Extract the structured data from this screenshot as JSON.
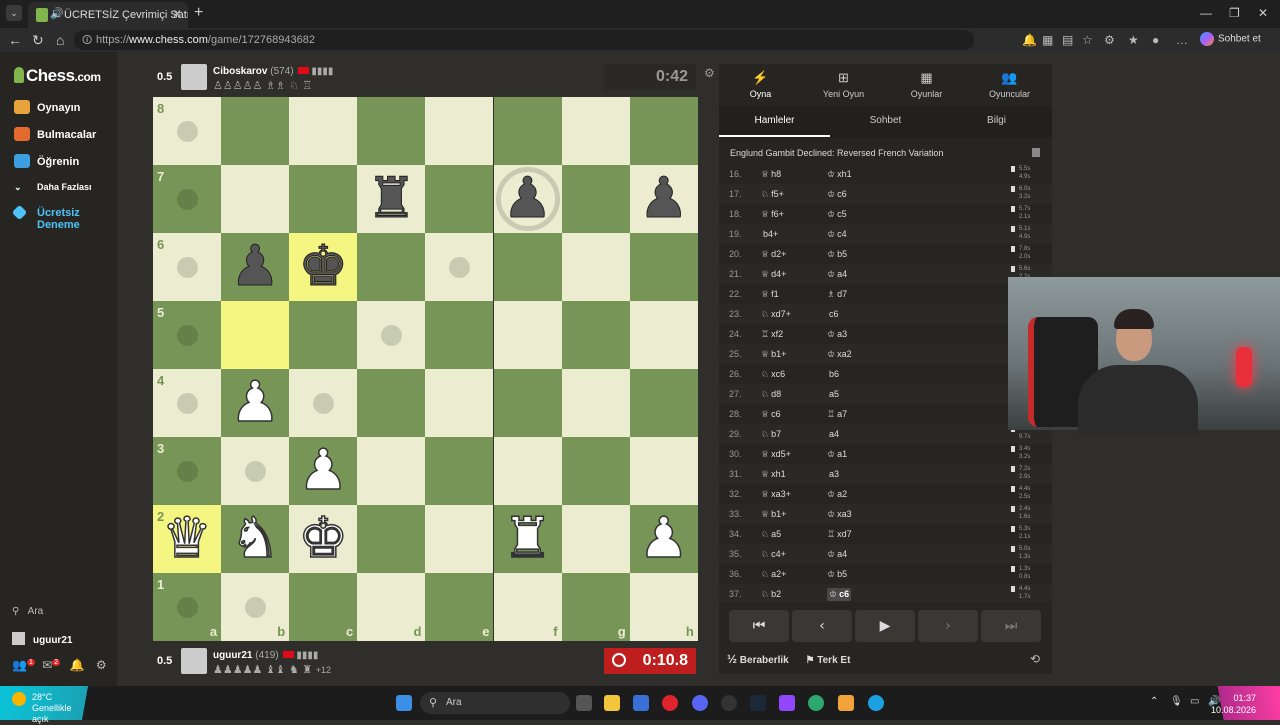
{
  "browser": {
    "tab_title": "ÜCRETSİZ Çevrimiçi Satranç Oy",
    "url_prefix": "https://",
    "url_domain": "www.chess.com",
    "url_path": "/game/172768943682",
    "copilot_label": "Sohbet et"
  },
  "sidebar": {
    "logo": "Chess",
    "logo_suffix": ".com",
    "items": [
      {
        "label": "Oynayın",
        "color": "#e8a33b"
      },
      {
        "label": "Bulmacalar",
        "color": "#e46a2f"
      },
      {
        "label": "Öğrenin",
        "color": "#3d9ee0"
      },
      {
        "label": "Daha Fazlası",
        "color": ""
      },
      {
        "label": "Ücretsiz Deneme",
        "color": "#4fc3f7"
      }
    ],
    "search_label": "Ara",
    "username": "uguur21",
    "friend_badge": "1",
    "mail_badge": "2"
  },
  "top_player": {
    "score": "0.5",
    "name": "Ciboskarov",
    "rating": "(574)",
    "captured": "♙♙♙♙♙ ♗♗ ♘ ♖",
    "clock": "0:42"
  },
  "bottom_player": {
    "score": "0.5",
    "name": "uguur21",
    "rating": "(419)",
    "captured": "♟♟♟♟♟ ♝♝ ♞ ♜",
    "advantage": "+12",
    "clock": "0:10.8"
  },
  "board": {
    "ranks": [
      "8",
      "7",
      "6",
      "5",
      "4",
      "3",
      "2",
      "1"
    ],
    "files": [
      "a",
      "b",
      "c",
      "d",
      "e",
      "f",
      "g",
      "h"
    ]
  },
  "panel": {
    "tabs": [
      {
        "icon": "⚡",
        "label": "Oyna"
      },
      {
        "icon": "⊞",
        "label": "Yeni Oyun"
      },
      {
        "icon": "▦",
        "label": "Oyunlar"
      },
      {
        "icon": "👥",
        "label": "Oyuncular"
      }
    ],
    "subtabs": [
      "Hamleler",
      "Sohbet",
      "Bilgi"
    ],
    "opening": "Englund Gambit Declined: Reversed French Variation",
    "moves": [
      {
        "n": "16.",
        "wi": "♕",
        "w": "h8",
        "bi": "♔",
        "b": "xh1",
        "t1": "5.5s",
        "t2": "4.9s"
      },
      {
        "n": "17.",
        "wi": "♘",
        "w": "f5+",
        "bi": "♔",
        "b": "c6",
        "t1": "6.0s",
        "t2": "3.2s"
      },
      {
        "n": "18.",
        "wi": "♕",
        "w": "f6+",
        "bi": "♔",
        "b": "c5",
        "t1": "5.7s",
        "t2": "2.1s"
      },
      {
        "n": "19.",
        "wi": "",
        "w": "b4+",
        "bi": "♔",
        "b": "c4",
        "t1": "5.1s",
        "t2": "4.9s"
      },
      {
        "n": "20.",
        "wi": "♕",
        "w": "d2+",
        "bi": "♔",
        "b": "b5",
        "t1": "7.8s",
        "t2": "2.0s"
      },
      {
        "n": "21.",
        "wi": "♕",
        "w": "d4+",
        "bi": "♔",
        "b": "a4",
        "t1": "5.6s",
        "t2": "2.2s"
      },
      {
        "n": "22.",
        "wi": "♕",
        "w": "f1",
        "bi": "♗",
        "b": "d7",
        "t1": "",
        "t2": ""
      },
      {
        "n": "23.",
        "wi": "♘",
        "w": "xd7+",
        "bi": "",
        "b": "c6",
        "t1": "",
        "t2": ""
      },
      {
        "n": "24.",
        "wi": "♖",
        "w": "xf2",
        "bi": "♔",
        "b": "a3",
        "t1": "",
        "t2": ""
      },
      {
        "n": "25.",
        "wi": "♕",
        "w": "b1+",
        "bi": "♔",
        "b": "xa2",
        "t1": "",
        "t2": ""
      },
      {
        "n": "26.",
        "wi": "♘",
        "w": "xc6",
        "bi": "",
        "b": "b6",
        "t1": "",
        "t2": ""
      },
      {
        "n": "27.",
        "wi": "♘",
        "w": "d8",
        "bi": "",
        "b": "a5",
        "t1": "",
        "t2": ""
      },
      {
        "n": "28.",
        "wi": "♕",
        "w": "c6",
        "bi": "♖",
        "b": "a7",
        "t1": "",
        "t2": ""
      },
      {
        "n": "29.",
        "wi": "♘",
        "w": "b7",
        "bi": "",
        "b": "a4",
        "t1": "",
        "t2": "9.7s"
      },
      {
        "n": "30.",
        "wi": "♕",
        "w": "xd5+",
        "bi": "♔",
        "b": "a1",
        "t1": "3.4s",
        "t2": "3.2s"
      },
      {
        "n": "31.",
        "wi": "♕",
        "w": "xh1",
        "bi": "",
        "b": "a3",
        "t1": "7.2s",
        "t2": "2.9s"
      },
      {
        "n": "32.",
        "wi": "♕",
        "w": "xa3+",
        "bi": "♔",
        "b": "a2",
        "t1": "4.4s",
        "t2": "2.5s"
      },
      {
        "n": "33.",
        "wi": "♕",
        "w": "b1+",
        "bi": "♔",
        "b": "xa3",
        "t1": "2.4s",
        "t2": "1.6s"
      },
      {
        "n": "34.",
        "wi": "♘",
        "w": "a5",
        "bi": "♖",
        "b": "xd7",
        "t1": "5.3s",
        "t2": "2.1s"
      },
      {
        "n": "35.",
        "wi": "♘",
        "w": "c4+",
        "bi": "♔",
        "b": "a4",
        "t1": "5.0s",
        "t2": "1.3s"
      },
      {
        "n": "36.",
        "wi": "♘",
        "w": "a2+",
        "bi": "♔",
        "b": "b5",
        "t1": "1.3s",
        "t2": "0.8s"
      },
      {
        "n": "37.",
        "wi": "♘",
        "w": "b2",
        "bi": "♔",
        "b": "c6",
        "t1": "4.4s",
        "t2": "1.7s"
      }
    ],
    "controls": [
      "⏮",
      "‹",
      "▶",
      "›",
      "⏭"
    ],
    "draw_label": "Beraberlik",
    "draw_icon": "½",
    "resign_label": "Terk Et"
  },
  "taskbar": {
    "temp": "28°C",
    "weather": "Genellikle açık",
    "search": "Ara",
    "time": "01:37",
    "date": "10.08.2026"
  }
}
